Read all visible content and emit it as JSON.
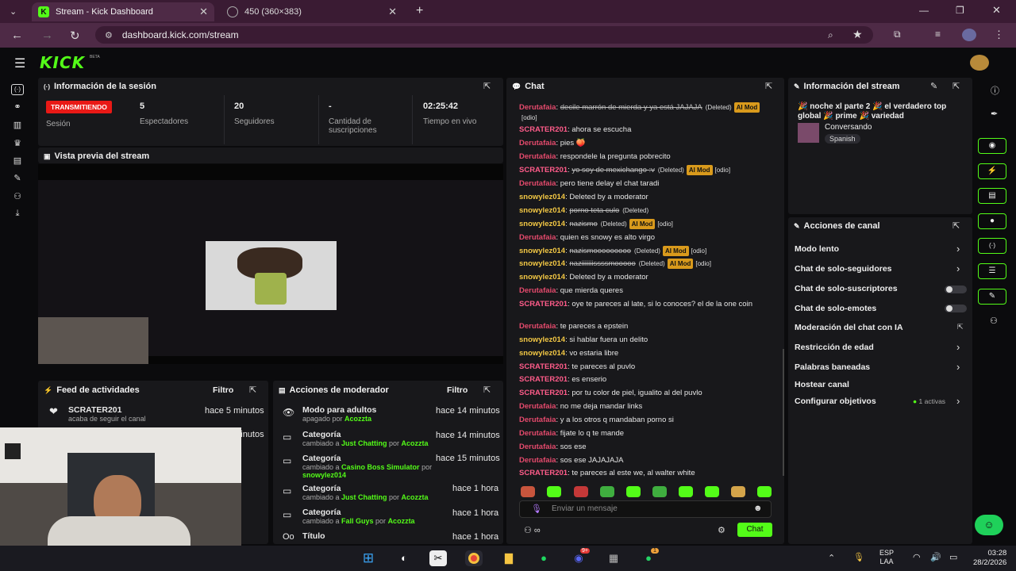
{
  "browser": {
    "tabs": [
      {
        "title": "Stream - Kick Dashboard",
        "active": true
      },
      {
        "title": "450 (360×383)",
        "active": false
      }
    ],
    "url": "dashboard.kick.com/stream"
  },
  "kick": {
    "logo": "KICK",
    "beta": "BETA"
  },
  "session": {
    "title": "Información de la sesión",
    "status_badge": "TRANSMITIENDO",
    "status_label": "Sesión",
    "stats": [
      {
        "value": "5",
        "label": "Espectadores"
      },
      {
        "value": "20",
        "label": "Seguidores"
      },
      {
        "value": "-",
        "label": "Cantidad de suscripciones"
      },
      {
        "value": "02:25:42",
        "label": "Tiempo en vivo"
      }
    ]
  },
  "preview": {
    "title": "Vista previa del stream"
  },
  "activity": {
    "title": "Feed de actividades",
    "filter": "Filtro",
    "items": [
      {
        "name": "SCRATER201",
        "sub": "acaba de seguir el canal",
        "time": "hace 5 minutos"
      },
      {
        "time": "hace 5 minutos"
      }
    ]
  },
  "modactions": {
    "title": "Acciones de moderador",
    "filter": "Filtro",
    "items": [
      {
        "name": "Modo para adultos",
        "pre": "apagado por ",
        "hl1": "Acozzta",
        "mid": "",
        "hl2": "",
        "time": "hace 14 minutos"
      },
      {
        "name": "Categoría",
        "pre": "cambiado a ",
        "hl1": "Just Chatting",
        "mid": " por ",
        "hl2": "Acozzta",
        "time": "hace 14 minutos"
      },
      {
        "name": "Categoría",
        "pre": "cambiado a ",
        "hl1": "Casino Boss Simulator",
        "mid": " por ",
        "hl2": "snowylez014",
        "time": "hace 15 minutos"
      },
      {
        "name": "Categoría",
        "pre": "cambiado a ",
        "hl1": "Just Chatting",
        "mid": " por ",
        "hl2": "Acozzta",
        "time": "hace 1 hora"
      },
      {
        "name": "Categoría",
        "pre": "cambiado a ",
        "hl1": "Fall Guys",
        "mid": " por ",
        "hl2": "Acozzta",
        "time": "hace 1 hora"
      },
      {
        "name": "Título",
        "pre": "",
        "hl1": "",
        "mid": "",
        "hl2": "",
        "time": "hace 1 hora"
      }
    ]
  },
  "chat": {
    "title": "Chat",
    "messages": [
      {
        "user": "Derutafaia",
        "text": "decile marrón de mierda y ya está JAJAJA",
        "deleted": true,
        "mod": true
      },
      {
        "user": "SCRATER201",
        "text": "ahora se escucha"
      },
      {
        "user": "Derutafaia",
        "text": "pies 🍑"
      },
      {
        "user": "Derutafaia",
        "text": "respondele la pregunta pobrecito"
      },
      {
        "user": "SCRATER201",
        "text": "yo soy de mexichango :v",
        "deleted": true,
        "mod": true
      },
      {
        "user": "Derutafaia",
        "text": "pero tiene delay el chat taradi"
      },
      {
        "user": "snowylez014",
        "text": "Deleted by a moderator"
      },
      {
        "user": "snowylez014",
        "text": "porno teta culo",
        "deleted": true
      },
      {
        "user": "snowylez014",
        "text": "nazismo",
        "deleted": true,
        "mod": true
      },
      {
        "user": "Derutafaia",
        "text": "quien es snowy es alto virgo"
      },
      {
        "user": "snowylez014",
        "text": "nazismooooooooo",
        "deleted": true,
        "mod": true
      },
      {
        "user": "snowylez014",
        "text": "naziiiiiiissssmooooo",
        "deleted": true,
        "mod": true
      },
      {
        "user": "snowylez014",
        "text": "Deleted by a moderator"
      },
      {
        "user": "Derutafaia",
        "text": "que mierda queres"
      },
      {
        "user": "SCRATER201",
        "text": "oye te pareces al late, si lo conoces? el de la one coin"
      },
      {
        "user": "Derutafaia",
        "text": "te pareces a epstein"
      },
      {
        "user": "snowylez014",
        "text": "si hablar fuera un delito"
      },
      {
        "user": "snowylez014",
        "text": "vo estaria libre"
      },
      {
        "user": "SCRATER201",
        "text": "te pareces al puvlo"
      },
      {
        "user": "SCRATER201",
        "text": "es enserio"
      },
      {
        "user": "SCRATER201",
        "text": "por tu color de piel, igualito al del puvlo"
      },
      {
        "user": "Derutafaia",
        "text": "no me deja mandar links"
      },
      {
        "user": "Derutafaia",
        "text": "y a los otros q mandaban porno si"
      },
      {
        "user": "Derutafaia",
        "text": "fijate lo q te mande"
      },
      {
        "user": "Derutafaia",
        "text": "sos ese"
      },
      {
        "user": "Derutafaia",
        "text": "sos ese JAJAJAJA"
      },
      {
        "user": "SCRATER201",
        "text": "te pareces al este we, al walter white"
      }
    ],
    "deleted_tag": "(Deleted)",
    "mod_tag": "AI Mod",
    "odio_tag": "[odio]",
    "input_placeholder": "Enviar un mensaje",
    "send": "Chat"
  },
  "streaminfo": {
    "title": "Información del stream",
    "stream_title": "🎉 noche xl parte 2 🎉 el verdadero top global 🎉 prime 🎉 variedad",
    "category": "Conversando",
    "language": "Spanish"
  },
  "channel": {
    "title": "Acciones de canal",
    "items": [
      {
        "label": "Modo lento",
        "control": "chevron"
      },
      {
        "label": "Chat de solo-seguidores",
        "control": "chevron"
      },
      {
        "label": "Chat de solo-suscriptores",
        "control": "toggle"
      },
      {
        "label": "Chat de solo-emotes",
        "control": "toggle"
      },
      {
        "label": "Moderación del chat con IA",
        "control": "external"
      },
      {
        "label": "Restricción de edad",
        "control": "chevron"
      },
      {
        "label": "Palabras baneadas",
        "control": "chevron"
      },
      {
        "label": "Hostear canal",
        "control": "none"
      },
      {
        "label": "Configurar objetivos",
        "control": "chevron"
      }
    ],
    "goals_badge": "1 activas"
  },
  "taskbar": {
    "lang1": "ESP",
    "lang2": "LAA",
    "time": "03:28",
    "date": "28/2/2026",
    "discord_badge": "9+",
    "whatsapp_badge": "1"
  },
  "colors": {
    "accent": "#53fc18",
    "badge_live": "#e91916",
    "mod_badge": "#d99a1c"
  }
}
